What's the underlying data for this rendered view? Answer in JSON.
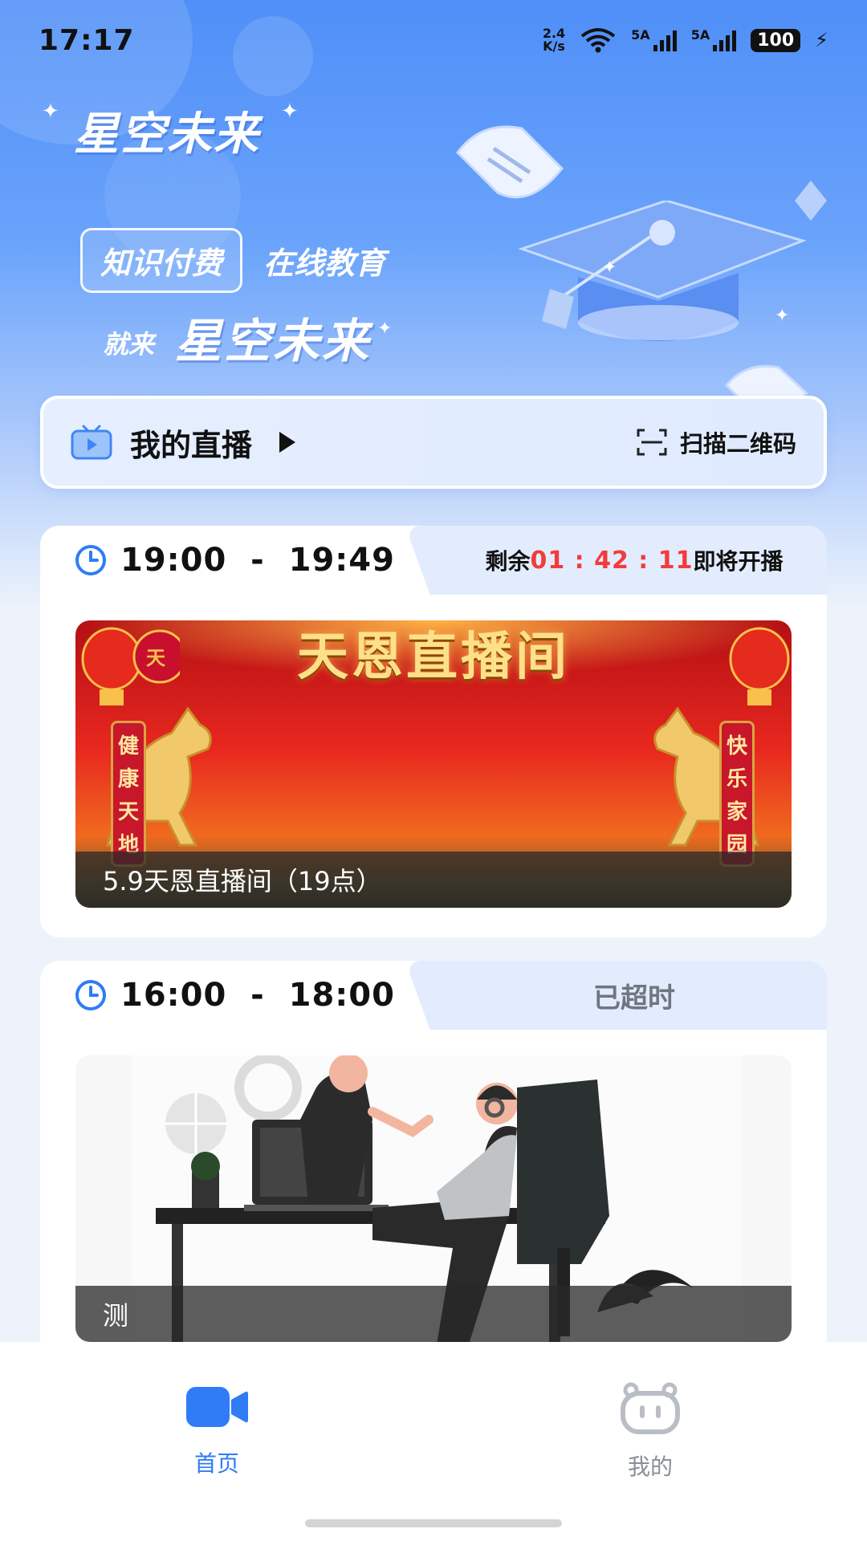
{
  "status_bar": {
    "time": "17:17",
    "net_speed_value": "2.4",
    "net_speed_unit": "K/s",
    "sim1_label": "5A",
    "sim2_label": "5A",
    "battery": "100"
  },
  "hero": {
    "brand": "星空未来",
    "tag_boxed": "知识付费",
    "tag_plain": "在线教育",
    "slogan_prefix": "就来",
    "slogan_brand": "星空未来"
  },
  "live_bar": {
    "title": "我的直播",
    "scan_label": "扫描二维码"
  },
  "sessions": [
    {
      "time_range": "19:00  -  19:49",
      "remain_prefix": "剩余",
      "countdown": "01 : 42 : 11",
      "remain_suffix": "即将开播",
      "banner_title": "天恩直播间",
      "left_banner": [
        "健",
        "康",
        "天",
        "地"
      ],
      "right_banner": [
        "快",
        "乐",
        "家",
        "园"
      ],
      "caption": "5.9天恩直播间（19点）"
    },
    {
      "time_range": "16:00  -  18:00",
      "status": "已超时",
      "caption": "测"
    }
  ],
  "tabbar": {
    "home_label": "首页",
    "mine_label": "我的",
    "active_color": "#2f7cf6",
    "inactive_color": "#8a8f97"
  }
}
